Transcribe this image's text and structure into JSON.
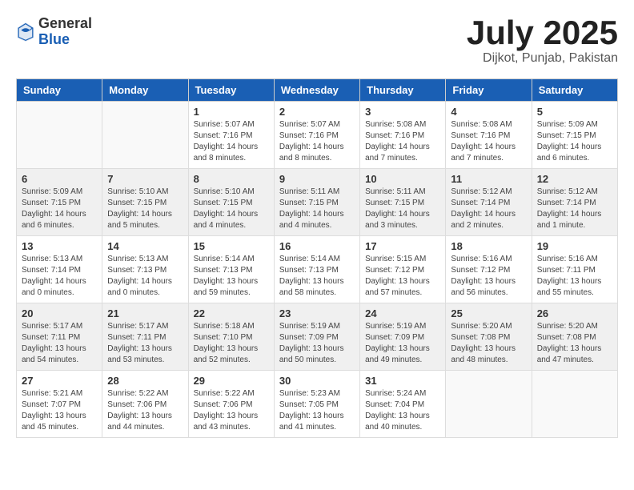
{
  "header": {
    "logo_general": "General",
    "logo_blue": "Blue",
    "month": "July 2025",
    "location": "Dijkot, Punjab, Pakistan"
  },
  "weekdays": [
    "Sunday",
    "Monday",
    "Tuesday",
    "Wednesday",
    "Thursday",
    "Friday",
    "Saturday"
  ],
  "weeks": [
    [
      {
        "day": "",
        "info": ""
      },
      {
        "day": "",
        "info": ""
      },
      {
        "day": "1",
        "info": "Sunrise: 5:07 AM\nSunset: 7:16 PM\nDaylight: 14 hours and 8 minutes."
      },
      {
        "day": "2",
        "info": "Sunrise: 5:07 AM\nSunset: 7:16 PM\nDaylight: 14 hours and 8 minutes."
      },
      {
        "day": "3",
        "info": "Sunrise: 5:08 AM\nSunset: 7:16 PM\nDaylight: 14 hours and 7 minutes."
      },
      {
        "day": "4",
        "info": "Sunrise: 5:08 AM\nSunset: 7:16 PM\nDaylight: 14 hours and 7 minutes."
      },
      {
        "day": "5",
        "info": "Sunrise: 5:09 AM\nSunset: 7:15 PM\nDaylight: 14 hours and 6 minutes."
      }
    ],
    [
      {
        "day": "6",
        "info": "Sunrise: 5:09 AM\nSunset: 7:15 PM\nDaylight: 14 hours and 6 minutes."
      },
      {
        "day": "7",
        "info": "Sunrise: 5:10 AM\nSunset: 7:15 PM\nDaylight: 14 hours and 5 minutes."
      },
      {
        "day": "8",
        "info": "Sunrise: 5:10 AM\nSunset: 7:15 PM\nDaylight: 14 hours and 4 minutes."
      },
      {
        "day": "9",
        "info": "Sunrise: 5:11 AM\nSunset: 7:15 PM\nDaylight: 14 hours and 4 minutes."
      },
      {
        "day": "10",
        "info": "Sunrise: 5:11 AM\nSunset: 7:15 PM\nDaylight: 14 hours and 3 minutes."
      },
      {
        "day": "11",
        "info": "Sunrise: 5:12 AM\nSunset: 7:14 PM\nDaylight: 14 hours and 2 minutes."
      },
      {
        "day": "12",
        "info": "Sunrise: 5:12 AM\nSunset: 7:14 PM\nDaylight: 14 hours and 1 minute."
      }
    ],
    [
      {
        "day": "13",
        "info": "Sunrise: 5:13 AM\nSunset: 7:14 PM\nDaylight: 14 hours and 0 minutes."
      },
      {
        "day": "14",
        "info": "Sunrise: 5:13 AM\nSunset: 7:13 PM\nDaylight: 14 hours and 0 minutes."
      },
      {
        "day": "15",
        "info": "Sunrise: 5:14 AM\nSunset: 7:13 PM\nDaylight: 13 hours and 59 minutes."
      },
      {
        "day": "16",
        "info": "Sunrise: 5:14 AM\nSunset: 7:13 PM\nDaylight: 13 hours and 58 minutes."
      },
      {
        "day": "17",
        "info": "Sunrise: 5:15 AM\nSunset: 7:12 PM\nDaylight: 13 hours and 57 minutes."
      },
      {
        "day": "18",
        "info": "Sunrise: 5:16 AM\nSunset: 7:12 PM\nDaylight: 13 hours and 56 minutes."
      },
      {
        "day": "19",
        "info": "Sunrise: 5:16 AM\nSunset: 7:11 PM\nDaylight: 13 hours and 55 minutes."
      }
    ],
    [
      {
        "day": "20",
        "info": "Sunrise: 5:17 AM\nSunset: 7:11 PM\nDaylight: 13 hours and 54 minutes."
      },
      {
        "day": "21",
        "info": "Sunrise: 5:17 AM\nSunset: 7:11 PM\nDaylight: 13 hours and 53 minutes."
      },
      {
        "day": "22",
        "info": "Sunrise: 5:18 AM\nSunset: 7:10 PM\nDaylight: 13 hours and 52 minutes."
      },
      {
        "day": "23",
        "info": "Sunrise: 5:19 AM\nSunset: 7:09 PM\nDaylight: 13 hours and 50 minutes."
      },
      {
        "day": "24",
        "info": "Sunrise: 5:19 AM\nSunset: 7:09 PM\nDaylight: 13 hours and 49 minutes."
      },
      {
        "day": "25",
        "info": "Sunrise: 5:20 AM\nSunset: 7:08 PM\nDaylight: 13 hours and 48 minutes."
      },
      {
        "day": "26",
        "info": "Sunrise: 5:20 AM\nSunset: 7:08 PM\nDaylight: 13 hours and 47 minutes."
      }
    ],
    [
      {
        "day": "27",
        "info": "Sunrise: 5:21 AM\nSunset: 7:07 PM\nDaylight: 13 hours and 45 minutes."
      },
      {
        "day": "28",
        "info": "Sunrise: 5:22 AM\nSunset: 7:06 PM\nDaylight: 13 hours and 44 minutes."
      },
      {
        "day": "29",
        "info": "Sunrise: 5:22 AM\nSunset: 7:06 PM\nDaylight: 13 hours and 43 minutes."
      },
      {
        "day": "30",
        "info": "Sunrise: 5:23 AM\nSunset: 7:05 PM\nDaylight: 13 hours and 41 minutes."
      },
      {
        "day": "31",
        "info": "Sunrise: 5:24 AM\nSunset: 7:04 PM\nDaylight: 13 hours and 40 minutes."
      },
      {
        "day": "",
        "info": ""
      },
      {
        "day": "",
        "info": ""
      }
    ]
  ]
}
